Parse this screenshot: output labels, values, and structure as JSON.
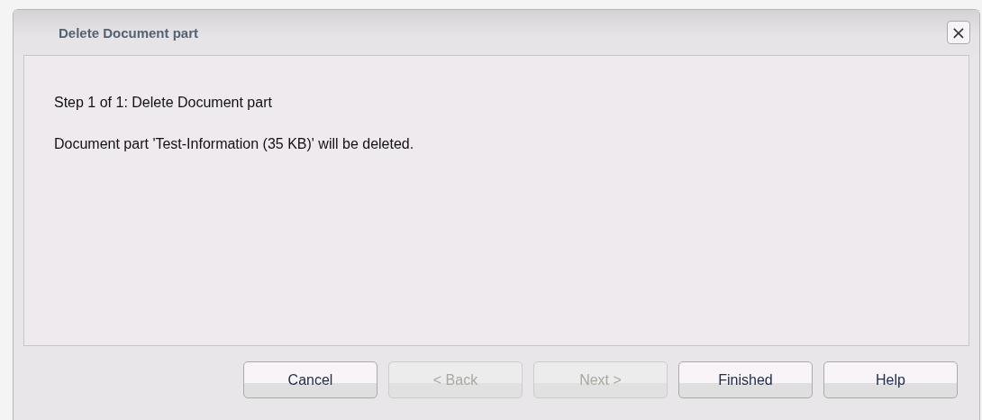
{
  "dialog": {
    "title": "Delete Document part",
    "close_label": "×"
  },
  "content": {
    "step": "Step 1 of 1: Delete Document part",
    "message": "Document part 'Test-Information (35 KB)' will be deleted."
  },
  "buttons": [
    {
      "label": "Cancel",
      "disabled": false
    },
    {
      "label": "< Back",
      "disabled": true
    },
    {
      "label": "Next >",
      "disabled": true
    },
    {
      "label": "Finished",
      "disabled": false
    },
    {
      "label": "Help",
      "disabled": false
    }
  ]
}
